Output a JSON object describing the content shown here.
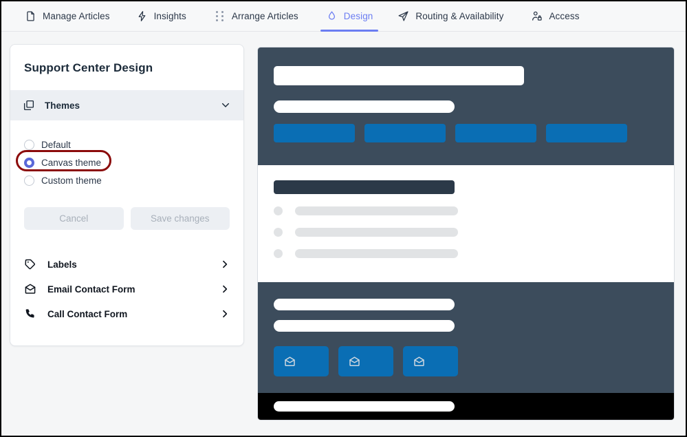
{
  "window": {
    "background": "#f5f6f7",
    "border_color": "#000000"
  },
  "tabbar": {
    "active_tab": "Design",
    "accent_color": "#6b7df2",
    "tabs": [
      {
        "label": "Manage Articles",
        "icon": "document-icon",
        "active": false
      },
      {
        "label": "Insights",
        "icon": "lightning-bolt-icon",
        "active": false
      },
      {
        "label": "Arrange Articles",
        "icon": "grip-dots-icon",
        "active": false
      },
      {
        "label": "Design",
        "icon": "droplet-icon",
        "active": true
      },
      {
        "label": "Routing & Availability",
        "icon": "paper-plane-icon",
        "active": false
      },
      {
        "label": "Access",
        "icon": "user-lock-icon",
        "active": false
      }
    ]
  },
  "sidebar": {
    "title": "Support Center Design",
    "themes_section": {
      "label": "Themes",
      "icon": "layers-icon",
      "chevron": "chevron-down-icon",
      "expanded": true,
      "options": [
        {
          "label": "Default",
          "selected": false
        },
        {
          "label": "Canvas theme",
          "selected": true,
          "highlighted": true
        },
        {
          "label": "Custom theme",
          "selected": false
        }
      ],
      "selected_option": "Canvas theme",
      "radio_color": "#5968d8",
      "highlight_color": "#8b0b0b",
      "buttons": [
        {
          "label": "Cancel",
          "disabled": true
        },
        {
          "label": "Save changes",
          "disabled": true
        }
      ]
    },
    "menu_items": [
      {
        "label": "Labels",
        "icon": "tag-icon",
        "chevron": "chevron-right-icon"
      },
      {
        "label": "Email Contact Form",
        "icon": "envelope-icon",
        "chevron": "chevron-right-icon"
      },
      {
        "label": "Call Contact Form",
        "icon": "phone-icon",
        "chevron": "chevron-right-icon"
      }
    ]
  },
  "preview": {
    "name": "theme-preview",
    "theme": "Canvas theme",
    "colors": {
      "hero_background": "#3c4c5c",
      "accent_button": "#0a6eb4",
      "body_background": "#ffffff",
      "heading_bar": "#2b3948",
      "placeholder_gray": "#e1e3e5",
      "footer_background": "#000000"
    },
    "hero": {
      "title_placeholder": "",
      "subtitle_placeholder": "",
      "chip_count": 4
    },
    "body": {
      "heading_placeholder": "",
      "line_count": 3
    },
    "contact": {
      "field_count": 2,
      "card_count": 3,
      "card_icon": "envelope-icon"
    },
    "footer": {
      "bar_placeholder": ""
    }
  }
}
